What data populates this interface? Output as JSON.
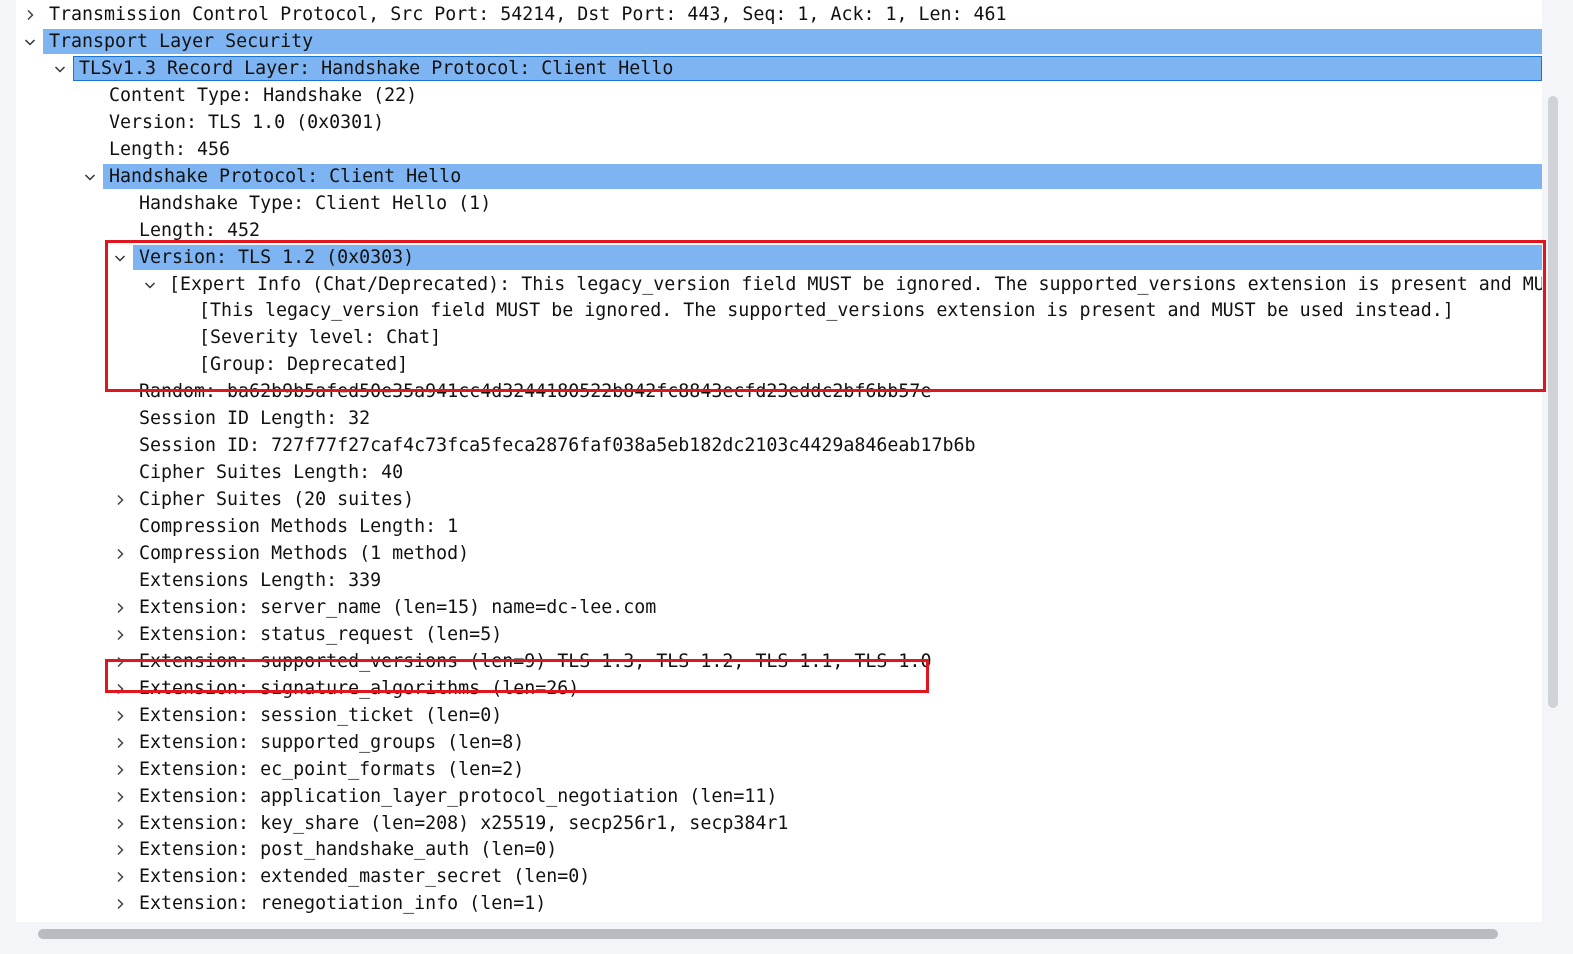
{
  "tree": {
    "rows": [
      {
        "text": "Transmission Control Protocol, Src Port: 54214, Dst Port: 443, Seq: 1, Ack: 1, Len: 461",
        "toggle": "collapsed"
      },
      {
        "text": "Transport Layer Security",
        "toggle": "expanded",
        "highlight": true
      },
      {
        "text": "TLSv1.3 Record Layer: Handshake Protocol: Client Hello",
        "toggle": "expanded",
        "highlight": true,
        "selected": true
      },
      {
        "text": "Content Type: Handshake (22)",
        "toggle": "none"
      },
      {
        "text": "Version: TLS 1.0 (0x0301)",
        "toggle": "none"
      },
      {
        "text": "Length: 456",
        "toggle": "none"
      },
      {
        "text": "Handshake Protocol: Client Hello",
        "toggle": "expanded",
        "highlight": true
      },
      {
        "text": "Handshake Type: Client Hello (1)",
        "toggle": "none"
      },
      {
        "text": "Length: 452",
        "toggle": "none"
      },
      {
        "text": "Version: TLS 1.2 (0x0303)",
        "toggle": "expanded",
        "highlight": true
      },
      {
        "text": "[Expert Info (Chat/Deprecated): This legacy_version field MUST be ignored. The supported_versions extension is present and MUST be used instead.]",
        "toggle": "expanded"
      },
      {
        "text": "[This legacy_version field MUST be ignored. The supported_versions extension is present and MUST be used instead.]",
        "toggle": "none"
      },
      {
        "text": "[Severity level: Chat]",
        "toggle": "none"
      },
      {
        "text": "[Group: Deprecated]",
        "toggle": "none"
      },
      {
        "text": "Random: ba62b9b5afed50e35a941cc4d3244180522b842fc8843ecfd23eddc2bf6bb57e",
        "toggle": "none"
      },
      {
        "text": "Session ID Length: 32",
        "toggle": "none"
      },
      {
        "text": "Session ID: 727f77f27caf4c73fca5feca2876faf038a5eb182dc2103c4429a846eab17b6b",
        "toggle": "none"
      },
      {
        "text": "Cipher Suites Length: 40",
        "toggle": "none"
      },
      {
        "text": "Cipher Suites (20 suites)",
        "toggle": "collapsed"
      },
      {
        "text": "Compression Methods Length: 1",
        "toggle": "none"
      },
      {
        "text": "Compression Methods (1 method)",
        "toggle": "collapsed"
      },
      {
        "text": "Extensions Length: 339",
        "toggle": "none"
      },
      {
        "text": "Extension: server_name (len=15) name=dc-lee.com",
        "toggle": "collapsed"
      },
      {
        "text": "Extension: status_request (len=5)",
        "toggle": "collapsed"
      },
      {
        "text": "Extension: supported_versions (len=9) TLS 1.3, TLS 1.2, TLS 1.1, TLS 1.0",
        "toggle": "collapsed"
      },
      {
        "text": "Extension: signature_algorithms (len=26)",
        "toggle": "collapsed"
      },
      {
        "text": "Extension: session_ticket (len=0)",
        "toggle": "collapsed"
      },
      {
        "text": "Extension: supported_groups (len=8)",
        "toggle": "collapsed"
      },
      {
        "text": "Extension: ec_point_formats (len=2)",
        "toggle": "collapsed"
      },
      {
        "text": "Extension: application_layer_protocol_negotiation (len=11)",
        "toggle": "collapsed"
      },
      {
        "text": "Extension: key_share (len=208) x25519, secp256r1, secp384r1",
        "toggle": "collapsed"
      },
      {
        "text": "Extension: post_handshake_auth (len=0)",
        "toggle": "collapsed"
      },
      {
        "text": "Extension: extended_master_secret (len=0)",
        "toggle": "collapsed"
      },
      {
        "text": "Extension: renegotiation_info (len=1)",
        "toggle": "collapsed"
      }
    ]
  },
  "colors": {
    "highlight": "#7db4f1",
    "annotation_box": "#e0161e",
    "selection_border": "#1a73d9"
  }
}
